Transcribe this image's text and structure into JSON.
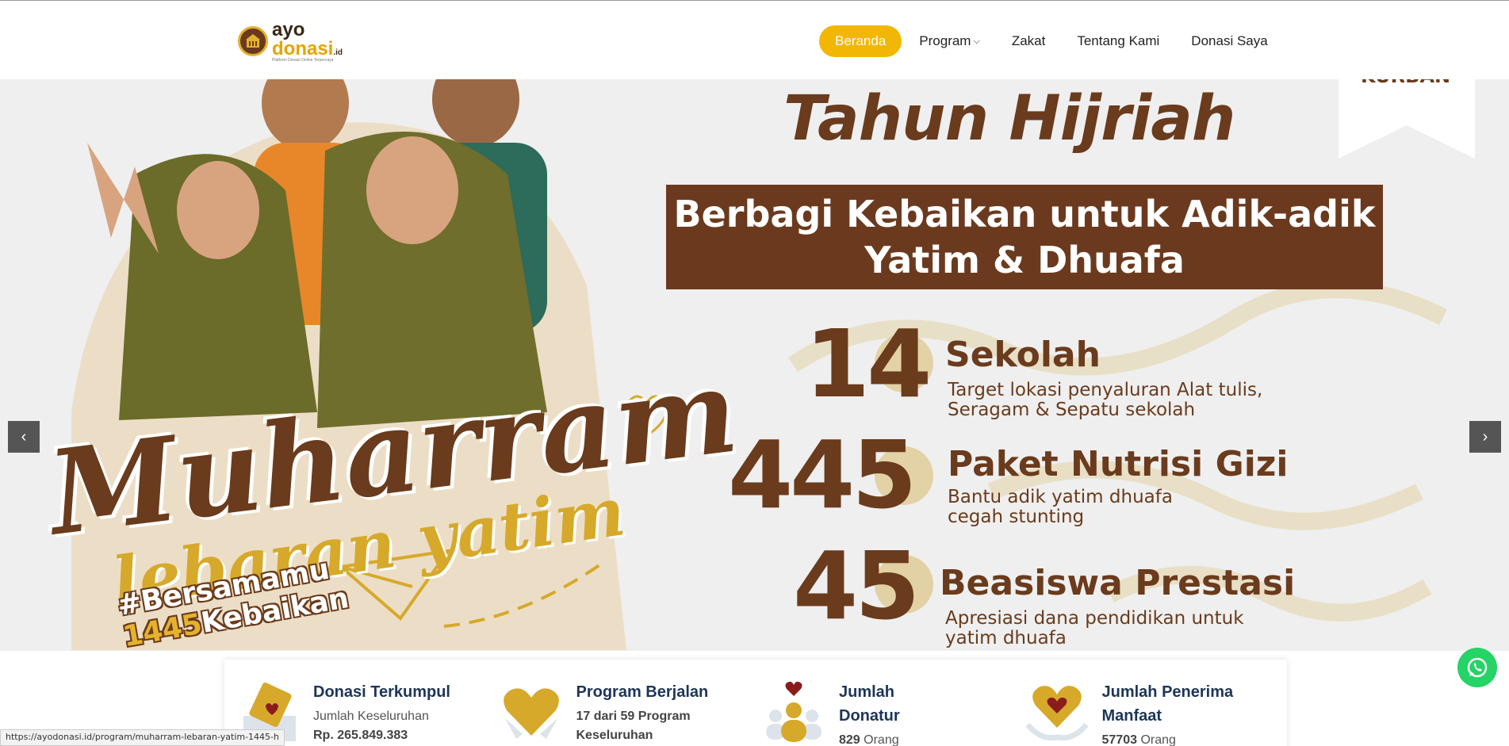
{
  "brand": {
    "ayo": "ayo",
    "donasi": "donasi",
    "id": ".id",
    "tagline": "Platform Donasi Online Terpercaya"
  },
  "nav": {
    "items": [
      {
        "label": "Beranda"
      },
      {
        "label": "Program"
      },
      {
        "label": "Zakat"
      },
      {
        "label": "Tentang Kami"
      },
      {
        "label": "Donasi Saya"
      }
    ]
  },
  "hero": {
    "corner": "KURBAN",
    "title": "Tahun Hijriah",
    "band_line1": "Berbagi Kebaikan untuk Adik-adik",
    "band_line2": "Yatim & Dhuafa",
    "stats": [
      {
        "num": "14",
        "label": "Sekolah",
        "sub1": "Target lokasi penyaluran Alat tulis,",
        "sub2": "Seragam & Sepatu sekolah"
      },
      {
        "num": "445",
        "label": "Paket Nutrisi Gizi",
        "sub1": "Bantu adik yatim dhuafa",
        "sub2": "cegah stunting"
      },
      {
        "num": "45",
        "label": "Beasiswa Prestasi",
        "sub1": "Apresiasi dana pendidikan untuk",
        "sub2": "yatim dhuafa"
      }
    ],
    "campaign": "Muharram",
    "campaign_sub": "lebaran yatim",
    "hashtag_1": "#Bersamamu",
    "hashtag_year": "1445",
    "hashtag_2": "Kebaikan",
    "prev": "‹",
    "next": "›"
  },
  "summary": [
    {
      "title": "Donasi Terkumpul",
      "sub": "Jumlah Keseluruhan",
      "value": "Rp. 265.849.383",
      "unit": ""
    },
    {
      "title": "Program Berjalan",
      "sub": "",
      "value": "17 dari 59 Program Keseluruhan",
      "unit": ""
    },
    {
      "title": "Jumlah Donatur",
      "sub": "",
      "value": "829",
      "unit": " Orang"
    },
    {
      "title": "Jumlah Penerima Manfaat",
      "sub": "",
      "value": "57703",
      "unit": " Orang"
    }
  ],
  "status_url": "https://ayodonasi.id/program/muharram-lebaran-yatim-1445-h",
  "colors": {
    "accent": "#f2b705",
    "brown": "#6b3a1e",
    "gold": "#d7a92b",
    "whatsapp": "#25d366"
  }
}
